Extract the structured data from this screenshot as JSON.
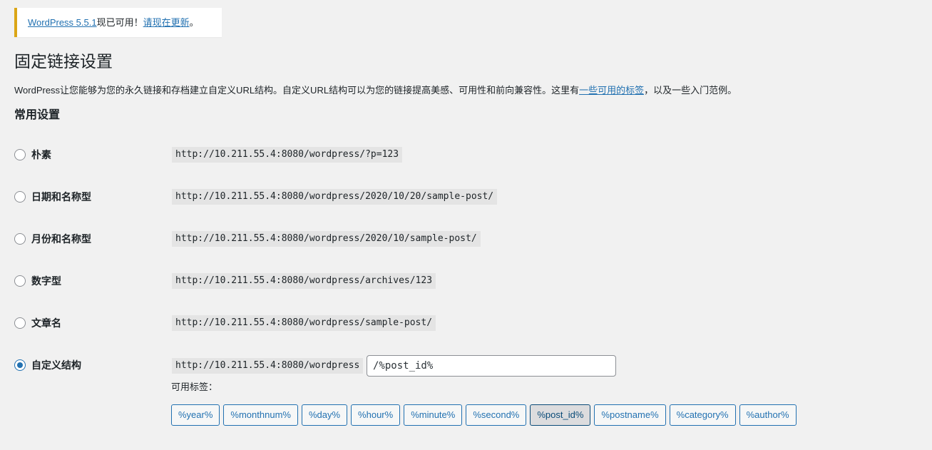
{
  "notice": {
    "version_link": "WordPress 5.5.1",
    "middle_text": "现已可用！",
    "update_link": "请现在更新",
    "end_text": "。"
  },
  "page": {
    "title": "固定链接设置",
    "intro_before": "WordPress让您能够为您的永久链接和存档建立自定义URL结构。自定义URL结构可以为您的链接提高美感、可用性和前向兼容性。这里有",
    "intro_link": "一些可用的标签",
    "intro_after": "，以及一些入门范例。",
    "section_title": "常用设置"
  },
  "options": [
    {
      "label": "朴素",
      "example": "http://10.211.55.4:8080/wordpress/?p=123",
      "checked": false
    },
    {
      "label": "日期和名称型",
      "example": "http://10.211.55.4:8080/wordpress/2020/10/20/sample-post/",
      "checked": false
    },
    {
      "label": "月份和名称型",
      "example": "http://10.211.55.4:8080/wordpress/2020/10/sample-post/",
      "checked": false
    },
    {
      "label": "数字型",
      "example": "http://10.211.55.4:8080/wordpress/archives/123",
      "checked": false
    },
    {
      "label": "文章名",
      "example": "http://10.211.55.4:8080/wordpress/sample-post/",
      "checked": false
    },
    {
      "label": "自定义结构",
      "example": "http://10.211.55.4:8080/wordpress",
      "checked": true
    }
  ],
  "custom": {
    "value": "/%post_id%",
    "tags_label": "可用标签：",
    "tags": [
      "%year%",
      "%monthnum%",
      "%day%",
      "%hour%",
      "%minute%",
      "%second%",
      "%post_id%",
      "%postname%",
      "%category%",
      "%author%"
    ],
    "active_tag": "%post_id%"
  },
  "colors": {
    "accent": "#2271b1",
    "notice_border": "#dba617"
  }
}
